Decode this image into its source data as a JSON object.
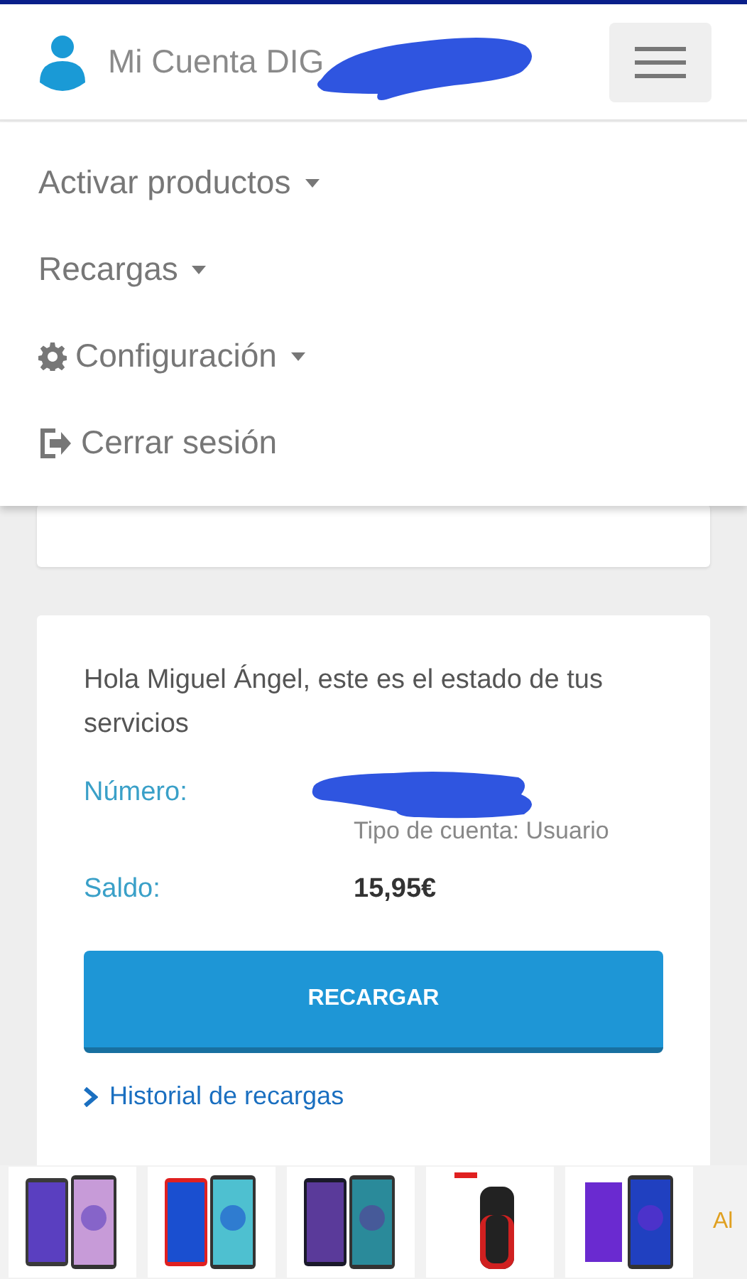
{
  "header": {
    "title": "Mi Cuenta DIG"
  },
  "menu": {
    "items": [
      {
        "label": "Activar productos",
        "kind": "plain",
        "dropdown": true
      },
      {
        "label": "Recargas",
        "kind": "plain",
        "dropdown": true
      },
      {
        "label": "Configuración",
        "kind": "settings",
        "dropdown": true
      },
      {
        "label": "Cerrar sesión",
        "kind": "logout",
        "dropdown": false
      }
    ]
  },
  "card": {
    "greeting": "Hola Miguel Ángel, este es el estado de tus servicios",
    "number": {
      "label": "Número:",
      "account_type": "Tipo de cuenta: Usuario"
    },
    "balance": {
      "label": "Saldo:",
      "value": "15,95€"
    },
    "button": "RECARGAR",
    "link": "Historial de recargas"
  },
  "ads": {
    "text": "Al"
  }
}
